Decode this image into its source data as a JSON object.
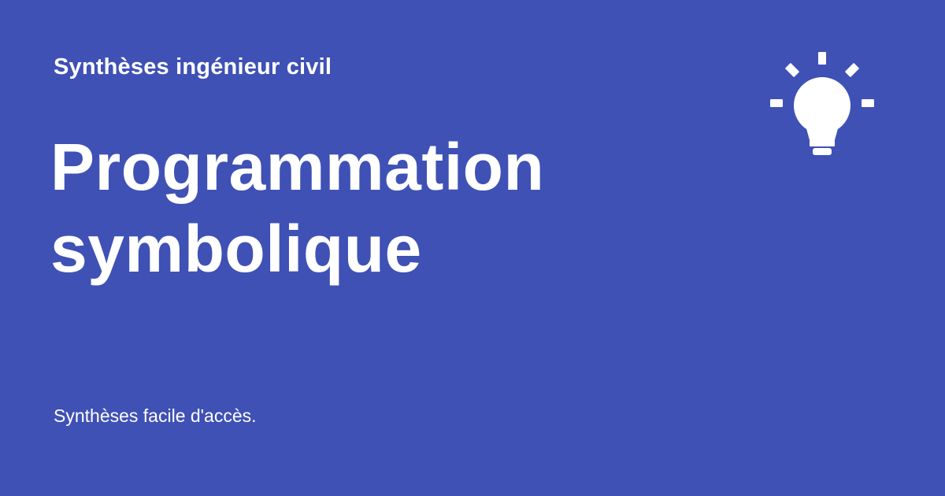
{
  "header": {
    "site_name": "Synthèses ingénieur civil"
  },
  "main": {
    "title": "Programmation symbolique",
    "tagline": "Synthèses facile d'accès."
  },
  "icons": {
    "decoration": "lightbulb-icon"
  },
  "colors": {
    "background": "#3f51b5",
    "foreground": "#ffffff"
  }
}
